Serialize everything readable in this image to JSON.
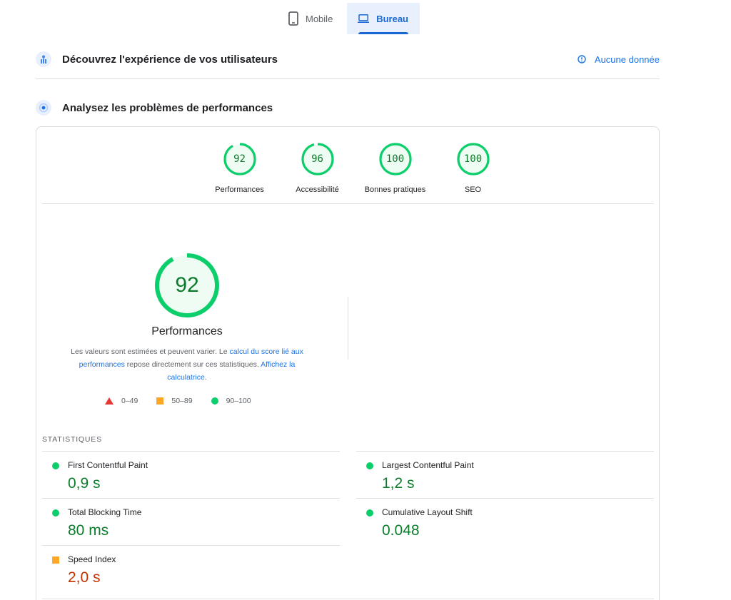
{
  "device_tabs": {
    "mobile_label": "Mobile",
    "desktop_label": "Bureau",
    "active": "Bureau"
  },
  "field_section": {
    "title": "Découvrez l'expérience de vos utilisateurs",
    "status": "Aucune donnée"
  },
  "lab_section": {
    "title": "Analysez les problèmes de performances"
  },
  "categories": [
    {
      "label": "Performances",
      "score": 92
    },
    {
      "label": "Accessibilité",
      "score": 96
    },
    {
      "label": "Bonnes pratiques",
      "score": 100
    },
    {
      "label": "SEO",
      "score": 100
    }
  ],
  "performance": {
    "score": 92,
    "title": "Performances",
    "desc_part1": "Les valeurs sont estimées et peuvent varier. Le ",
    "link1": "calcul du score lié aux performances",
    "desc_part2": " repose directement sur ces statistiques. ",
    "link2": "Affichez la calculatrice",
    "desc_end": "."
  },
  "legend": {
    "fail": "0–49",
    "average": "50–89",
    "pass": "90–100"
  },
  "statistics": {
    "title": "STATISTIQUES",
    "metrics": [
      {
        "name": "First Contentful Paint",
        "value": "0,9 s",
        "rating": "pass"
      },
      {
        "name": "Largest Contentful Paint",
        "value": "1,2 s",
        "rating": "pass"
      },
      {
        "name": "Total Blocking Time",
        "value": "80 ms",
        "rating": "pass"
      },
      {
        "name": "Cumulative Layout Shift",
        "value": "0.048",
        "rating": "pass"
      },
      {
        "name": "Speed Index",
        "value": "2,0 s",
        "rating": "average"
      }
    ]
  },
  "colors": {
    "pass": "#0cce6b",
    "pass_text": "#0c7c2c",
    "average": "#ffa726",
    "average_text": "#c33300",
    "fail": "#e53935",
    "accent": "#1a73e8"
  }
}
